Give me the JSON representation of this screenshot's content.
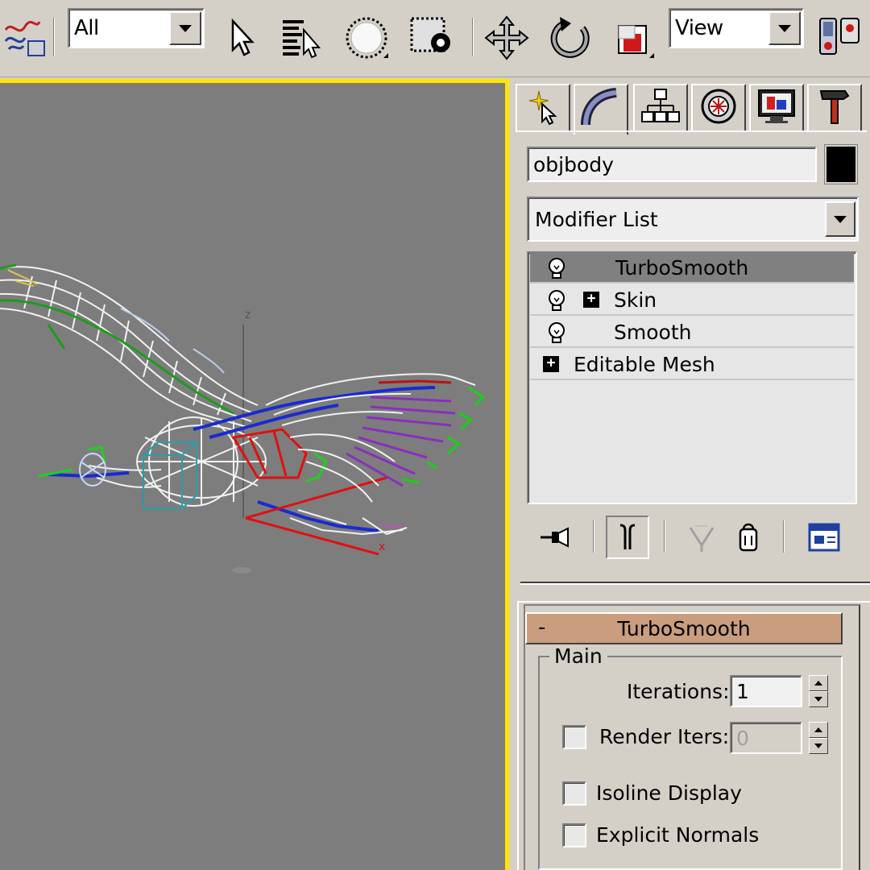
{
  "toolbar": {
    "selection_filter": "All",
    "reference_coord": "View",
    "icons": [
      "schematic-icon",
      "select-object-icon",
      "select-by-name-icon",
      "circular-selection-region-icon",
      "window-crossing-icon",
      "select-and-move-icon",
      "select-and-rotate-icon",
      "select-and-scale-icon",
      "use-pivot-center-icon"
    ]
  },
  "command_panel": {
    "tabs": [
      "create-tab",
      "modify-tab",
      "hierarchy-tab",
      "motion-tab",
      "display-tab",
      "utilities-tab"
    ],
    "active_tab": "modify-tab",
    "object_name": "objbody",
    "object_color": "#000000",
    "modifier_list_label": "Modifier List",
    "stack": [
      {
        "label": "TurboSmooth",
        "selected": true,
        "has_bulb": true,
        "has_plus": false
      },
      {
        "label": "Skin",
        "selected": false,
        "has_bulb": true,
        "has_plus": true
      },
      {
        "label": "Smooth",
        "selected": false,
        "has_bulb": true,
        "has_plus": false
      },
      {
        "label": "Editable Mesh",
        "selected": false,
        "has_bulb": false,
        "has_plus": true
      }
    ]
  },
  "rollout": {
    "collapse_symbol": "-",
    "title": "TurboSmooth",
    "group_title": "Main",
    "iterations_label": "Iterations:",
    "iterations_value": "1",
    "render_iters_label": "Render Iters:",
    "render_iters_value": "0",
    "render_iters_checked": false,
    "isoline_label": "Isoline Display",
    "isoline_checked": false,
    "explicit_normals_label": "Explicit Normals",
    "explicit_normals_checked": false
  },
  "viewport": {
    "axis_label": "z",
    "gizmo_axis_label": "x",
    "border_color": "#ffe600"
  }
}
